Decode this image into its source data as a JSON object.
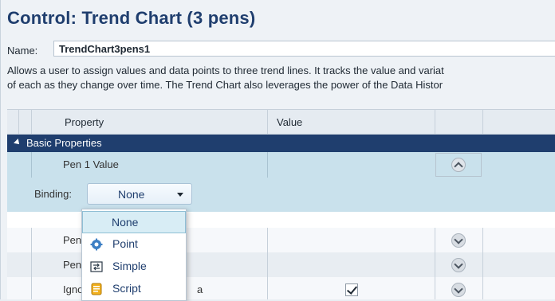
{
  "control": {
    "title": "Control: Trend Chart (3 pens)",
    "name_label": "Name:",
    "name_value": "TrendChart3pens1",
    "description_line1": "Allows a user to assign values and data points to three trend lines. It tracks the value and variat",
    "description_line2": "of each as they change over time. The Trend Chart also leverages the power of the Data Histor"
  },
  "grid": {
    "headers": {
      "property": "Property",
      "value": "Value"
    },
    "group_label": "Basic Properties",
    "rows": [
      {
        "property": "Pen 1 Value",
        "value": "",
        "expanded": true
      },
      {
        "property": "Pen",
        "value": ""
      },
      {
        "property": "Pen",
        "value": ""
      },
      {
        "property": "Igno",
        "suffix": "a",
        "checked": true
      }
    ],
    "binding": {
      "label": "Binding:",
      "selected": "None"
    }
  },
  "dropdown": {
    "options": [
      {
        "label": "None",
        "icon": ""
      },
      {
        "label": "Point",
        "icon": "gear-icon"
      },
      {
        "label": "Simple",
        "icon": "simple-binding-icon"
      },
      {
        "label": "Script",
        "icon": "script-icon"
      }
    ]
  },
  "colors": {
    "title": "#1f3e6e",
    "group_header": "#1f3e6e",
    "selected_row": "#c9e1ec"
  }
}
